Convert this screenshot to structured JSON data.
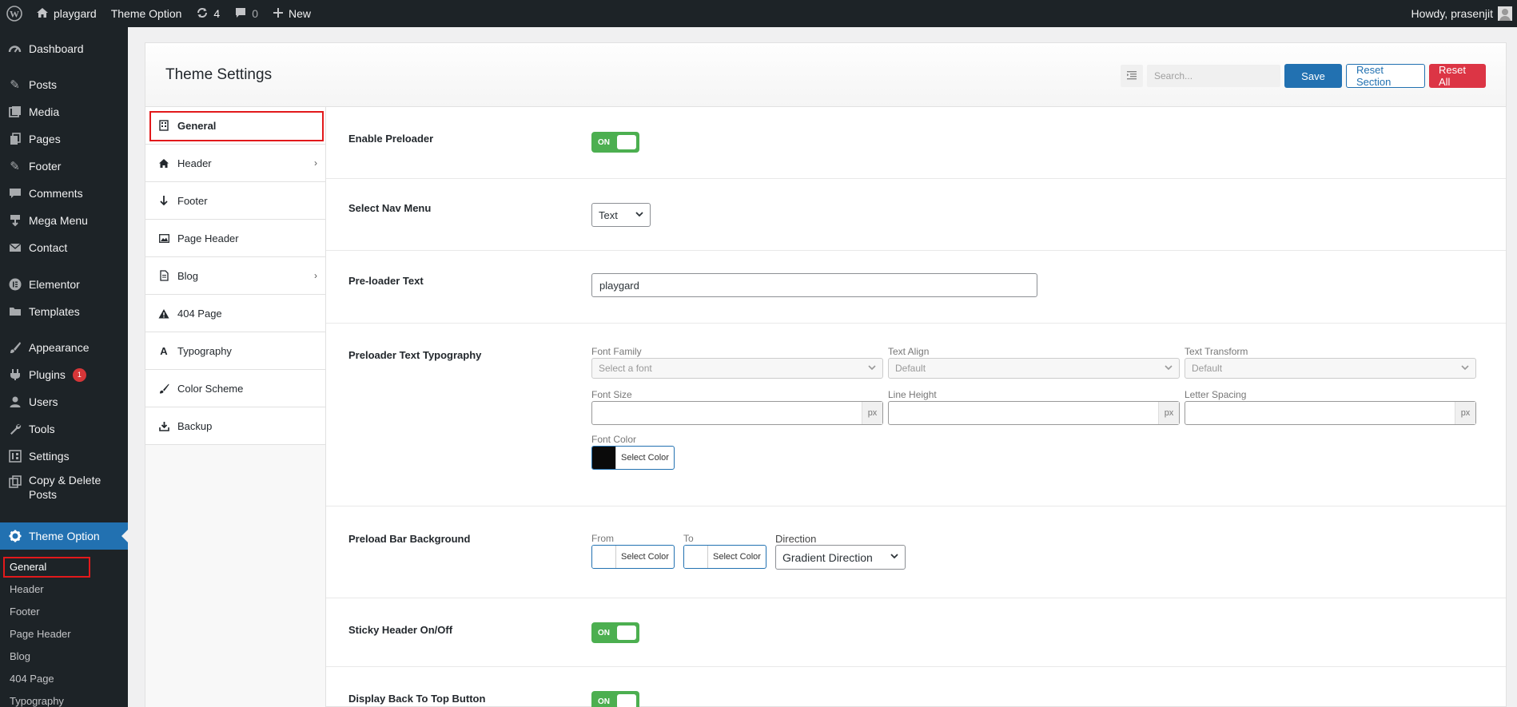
{
  "adminbar": {
    "site_name": "playgard",
    "theme_option": "Theme Option",
    "updates_count": "4",
    "comments_count": "0",
    "new_label": "New",
    "howdy": "Howdy, prasenjit"
  },
  "adminmenu": {
    "items": [
      {
        "label": "Dashboard",
        "icon": "dashboard-icon"
      },
      {
        "label": "Posts",
        "icon": "pin-icon"
      },
      {
        "label": "Media",
        "icon": "media-icon"
      },
      {
        "label": "Pages",
        "icon": "pages-icon"
      },
      {
        "label": "Footer",
        "icon": "pin-icon"
      },
      {
        "label": "Comments",
        "icon": "comment-icon"
      },
      {
        "label": "Mega Menu",
        "icon": "download-icon"
      },
      {
        "label": "Contact",
        "icon": "mail-icon"
      },
      {
        "label": "Elementor",
        "icon": "elementor-icon"
      },
      {
        "label": "Templates",
        "icon": "folder-icon"
      },
      {
        "label": "Appearance",
        "icon": "brush-icon"
      },
      {
        "label": "Plugins",
        "icon": "plugin-icon",
        "badge": "1"
      },
      {
        "label": "Users",
        "icon": "user-icon"
      },
      {
        "label": "Tools",
        "icon": "wrench-icon"
      },
      {
        "label": "Settings",
        "icon": "settings-icon"
      },
      {
        "label": "Copy & Delete",
        "label2": "Posts",
        "icon": "copy-icon"
      },
      {
        "label": "Theme Option",
        "icon": "gear-icon"
      }
    ],
    "submenu": [
      "General",
      "Header",
      "Footer",
      "Page Header",
      "Blog",
      "404 Page",
      "Typography"
    ]
  },
  "panel": {
    "title": "Theme Settings",
    "search_placeholder": "Search...",
    "save": "Save",
    "reset_section": "Reset Section",
    "reset_all": "Reset All"
  },
  "sections": [
    {
      "label": "General",
      "icon": "building-icon"
    },
    {
      "label": "Header",
      "icon": "home-icon",
      "has_children": true
    },
    {
      "label": "Footer",
      "icon": "arrow-down-icon"
    },
    {
      "label": "Page Header",
      "icon": "image-icon"
    },
    {
      "label": "Blog",
      "icon": "document-icon",
      "has_children": true
    },
    {
      "label": "404 Page",
      "icon": "warning-icon"
    },
    {
      "label": "Typography",
      "icon": "font-icon"
    },
    {
      "label": "Color Scheme",
      "icon": "brush-icon"
    },
    {
      "label": "Backup",
      "icon": "download-icon"
    }
  ],
  "fields": {
    "enable_preloader": {
      "label": "Enable Preloader",
      "value": "ON"
    },
    "nav_menu": {
      "label": "Select Nav Menu",
      "value": "Text"
    },
    "preloader_text": {
      "label": "Pre-loader Text",
      "value": "playgard"
    },
    "typography": {
      "label": "Preloader Text Typography",
      "font_family_label": "Font Family",
      "font_family_placeholder": "Select a font",
      "text_align_label": "Text Align",
      "text_align_value": "Default",
      "text_transform_label": "Text Transform",
      "text_transform_value": "Default",
      "font_size_label": "Font Size",
      "line_height_label": "Line Height",
      "letter_spacing_label": "Letter Spacing",
      "unit": "px",
      "font_color_label": "Font Color",
      "font_color_value": "#0a0a0a",
      "select_color": "Select Color"
    },
    "preload_bar": {
      "label": "Preload Bar Background",
      "from_label": "From",
      "to_label": "To",
      "direction_label": "Direction",
      "direction_value": "Gradient Direction",
      "select_color": "Select Color"
    },
    "sticky_header": {
      "label": "Sticky Header On/Off",
      "value": "ON"
    },
    "back_to_top": {
      "label": "Display Back To Top Button",
      "value": "ON"
    }
  },
  "colors": {
    "accent": "#2271b1",
    "danger": "#dc3545",
    "toggle_on": "#4caf50",
    "admin_dark": "#1d2327",
    "highlight_box": "#e2191b"
  }
}
